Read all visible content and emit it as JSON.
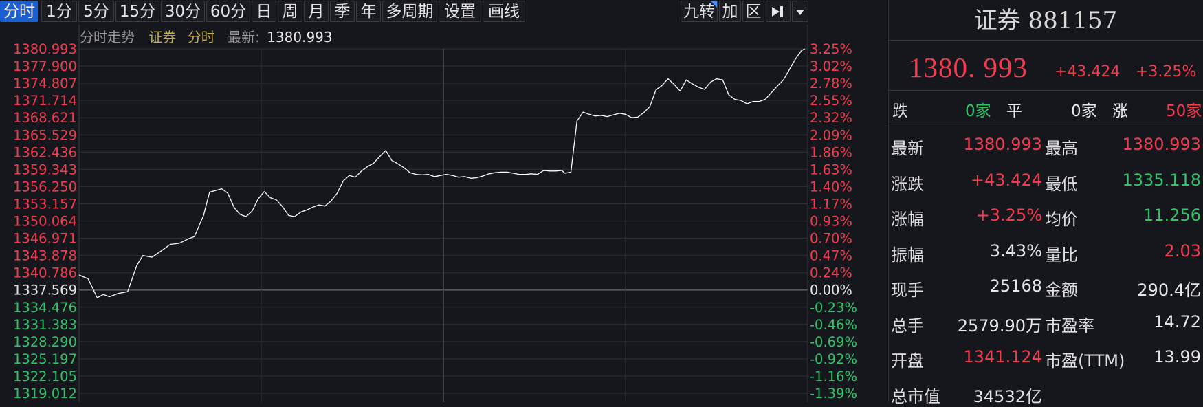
{
  "toolbar": {
    "periods": [
      "分时",
      "1分",
      "5分",
      "15分",
      "30分",
      "60分",
      "日",
      "周",
      "月",
      "季",
      "年",
      "多周期",
      "设置",
      "画线"
    ],
    "active_period": "分时",
    "tools": [
      "九转",
      "加",
      "区"
    ]
  },
  "chart_header": {
    "section": "分时走势",
    "name": "证券",
    "mode": "分时",
    "latest_label": "最新:",
    "latest_value": "1380.993"
  },
  "chart_data": {
    "type": "line",
    "title": "",
    "prev_close": 1337.569,
    "ylim": [
      1319.012,
      1380.993
    ],
    "y_ticks_left": [
      "1380.993",
      "1377.900",
      "1374.807",
      "1371.714",
      "1368.621",
      "1365.529",
      "1362.436",
      "1359.343",
      "1356.250",
      "1353.157",
      "1350.064",
      "1346.971",
      "1343.878",
      "1340.786",
      "1337.569",
      "1334.476",
      "1331.383",
      "1328.290",
      "1325.197",
      "1322.105",
      "1319.012"
    ],
    "y_ticks_right": [
      "3.25%",
      "3.02%",
      "2.78%",
      "2.55%",
      "2.32%",
      "2.09%",
      "1.86%",
      "1.63%",
      "1.40%",
      "1.17%",
      "0.93%",
      "0.70%",
      "0.47%",
      "0.24%",
      "0.00%",
      "-0.23%",
      "-0.46%",
      "-0.69%",
      "-0.92%",
      "-1.16%",
      "-1.39%"
    ],
    "x_range": [
      0,
      240
    ],
    "series": [
      {
        "values": [
          [
            0,
            1340.3
          ],
          [
            3,
            1339.6
          ],
          [
            6,
            1336.2
          ],
          [
            8,
            1336.8
          ],
          [
            10,
            1336.4
          ],
          [
            13,
            1337.0
          ],
          [
            16,
            1337.3
          ],
          [
            19,
            1342.0
          ],
          [
            21,
            1343.8
          ],
          [
            24,
            1343.5
          ],
          [
            27,
            1344.6
          ],
          [
            30,
            1345.8
          ],
          [
            33,
            1346.0
          ],
          [
            36,
            1346.8
          ],
          [
            38,
            1347.2
          ],
          [
            41,
            1351.0
          ],
          [
            43,
            1355.2
          ],
          [
            45,
            1355.5
          ],
          [
            47,
            1355.8
          ],
          [
            49,
            1355.0
          ],
          [
            51,
            1352.5
          ],
          [
            53,
            1351.2
          ],
          [
            55,
            1350.8
          ],
          [
            57,
            1351.8
          ],
          [
            59,
            1354.0
          ],
          [
            61,
            1355.3
          ],
          [
            63,
            1354.2
          ],
          [
            65,
            1353.8
          ],
          [
            67,
            1352.6
          ],
          [
            69,
            1351.0
          ],
          [
            71,
            1350.8
          ],
          [
            73,
            1351.6
          ],
          [
            75,
            1352.0
          ],
          [
            77,
            1352.5
          ],
          [
            79,
            1352.9
          ],
          [
            81,
            1352.7
          ],
          [
            83,
            1353.6
          ],
          [
            85,
            1355.0
          ],
          [
            87,
            1357.2
          ],
          [
            89,
            1358.2
          ],
          [
            91,
            1357.9
          ],
          [
            93,
            1359.0
          ],
          [
            95,
            1359.8
          ],
          [
            97,
            1360.4
          ],
          [
            99,
            1361.6
          ],
          [
            101,
            1362.7
          ],
          [
            103,
            1360.9
          ],
          [
            105,
            1360.3
          ],
          [
            107,
            1359.6
          ],
          [
            109,
            1358.7
          ],
          [
            111,
            1358.4
          ],
          [
            113,
            1358.3
          ],
          [
            115,
            1358.4
          ],
          [
            117,
            1358.0
          ],
          [
            119,
            1358.2
          ],
          [
            121,
            1358.4
          ],
          [
            123,
            1358.2
          ],
          [
            125,
            1357.9
          ],
          [
            127,
            1358.0
          ],
          [
            129,
            1357.7
          ],
          [
            131,
            1357.8
          ],
          [
            133,
            1358.1
          ],
          [
            135,
            1358.5
          ],
          [
            137,
            1358.7
          ],
          [
            139,
            1358.8
          ],
          [
            141,
            1358.8
          ],
          [
            143,
            1358.6
          ],
          [
            145,
            1358.4
          ],
          [
            147,
            1358.4
          ],
          [
            149,
            1358.5
          ],
          [
            151,
            1358.4
          ],
          [
            153,
            1359.1
          ],
          [
            155,
            1359.0
          ],
          [
            157,
            1359.0
          ],
          [
            159,
            1359.1
          ],
          [
            160,
            1358.6
          ],
          [
            162,
            1358.8
          ],
          [
            164,
            1368.0
          ],
          [
            166,
            1369.6
          ],
          [
            168,
            1369.2
          ],
          [
            170,
            1368.9
          ],
          [
            172,
            1369.0
          ],
          [
            174,
            1368.8
          ],
          [
            176,
            1369.1
          ],
          [
            178,
            1369.4
          ],
          [
            180,
            1369.2
          ],
          [
            182,
            1368.6
          ],
          [
            184,
            1368.7
          ],
          [
            186,
            1369.5
          ],
          [
            188,
            1370.6
          ],
          [
            190,
            1373.6
          ],
          [
            192,
            1374.4
          ],
          [
            194,
            1375.6
          ],
          [
            196,
            1374.6
          ],
          [
            198,
            1373.4
          ],
          [
            200,
            1375.4
          ],
          [
            202,
            1374.7
          ],
          [
            204,
            1374.1
          ],
          [
            206,
            1373.7
          ],
          [
            208,
            1375.0
          ],
          [
            210,
            1375.6
          ],
          [
            212,
            1375.4
          ],
          [
            214,
            1372.7
          ],
          [
            216,
            1371.9
          ],
          [
            218,
            1371.7
          ],
          [
            220,
            1371.1
          ],
          [
            222,
            1371.5
          ],
          [
            224,
            1371.5
          ],
          [
            226,
            1371.9
          ],
          [
            228,
            1373.1
          ],
          [
            230,
            1374.3
          ],
          [
            232,
            1375.4
          ],
          [
            234,
            1377.3
          ],
          [
            236,
            1379.2
          ],
          [
            238,
            1380.7
          ],
          [
            239,
            1380.993
          ]
        ]
      }
    ],
    "grid": true
  },
  "quote": {
    "title": "证券 881157",
    "price": "1380. 993",
    "change": "+43.424",
    "change_pct": "+3.25%"
  },
  "breadth": {
    "down_label": "跌",
    "down_value": "0家",
    "flat_label": "平",
    "flat_value": "0家",
    "up_label": "涨",
    "up_value": "50家"
  },
  "stats": [
    {
      "left_label": "最新",
      "left_value": "1380.993",
      "left_color": "red",
      "right_label": "最高",
      "right_value": "1380.993",
      "right_color": "red"
    },
    {
      "left_label": "涨跌",
      "left_value": "+43.424",
      "left_color": "red",
      "right_label": "最低",
      "right_value": "1335.118",
      "right_color": "green"
    },
    {
      "left_label": "涨幅",
      "left_value": "+3.25%",
      "left_color": "red",
      "right_label": "均价",
      "right_value": "11.256",
      "right_color": "green"
    },
    {
      "left_label": "振幅",
      "left_value": "3.43%",
      "left_color": "white",
      "right_label": "量比",
      "right_value": "2.03",
      "right_color": "red"
    },
    {
      "left_label": "现手",
      "left_value": "25168",
      "left_color": "white",
      "right_label": "金额",
      "right_value": "290.4亿",
      "right_color": "white"
    },
    {
      "left_label": "总手",
      "left_value": "2579.90万",
      "left_color": "white",
      "right_label": "市盈率",
      "right_value": "14.72",
      "right_color": "white"
    },
    {
      "left_label": "开盘",
      "left_value": "1341.124",
      "left_color": "red",
      "right_label": "市盈(TTM)",
      "right_value": "13.99",
      "right_color": "white"
    },
    {
      "left_label": "总市值",
      "left_value": "34532亿",
      "left_color": "white",
      "right_label": "",
      "right_value": "",
      "right_color": "white"
    }
  ],
  "colors": {
    "up": "#f23b4e",
    "down": "#2fc36a",
    "neutral": "#e6e6e6",
    "line": "#ffffff",
    "grid": "#2e3036",
    "active": "#1b5fd0"
  }
}
